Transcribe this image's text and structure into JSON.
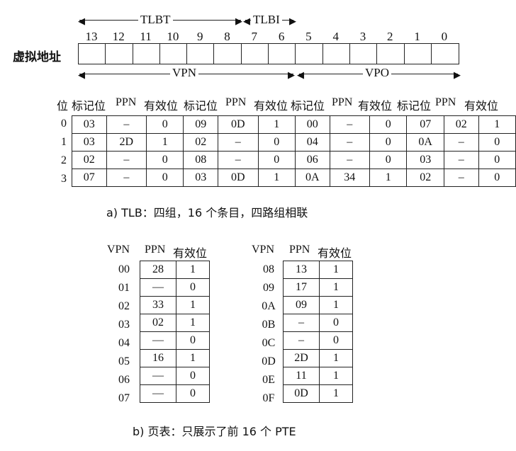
{
  "address": {
    "label": "虚拟地址",
    "bits": [
      "13",
      "12",
      "11",
      "10",
      "9",
      "8",
      "7",
      "6",
      "5",
      "4",
      "3",
      "2",
      "1",
      "0"
    ],
    "tlbt_label": "TLBT",
    "tlbi_label": "TLBI",
    "vpn_label": "VPN",
    "vpo_label": "VPO"
  },
  "tlb": {
    "set_header": "位",
    "columns": [
      "标记位",
      "PPN",
      "有效位",
      "标记位",
      "PPN",
      "有效位",
      "标记位",
      "PPN",
      "有效位",
      "标记位",
      "PPN",
      "有效位"
    ],
    "rows": [
      {
        "set": "0",
        "cells": [
          "03",
          "–",
          "0",
          "09",
          "0D",
          "1",
          "00",
          "–",
          "0",
          "07",
          "02",
          "1"
        ]
      },
      {
        "set": "1",
        "cells": [
          "03",
          "2D",
          "1",
          "02",
          "–",
          "0",
          "04",
          "–",
          "0",
          "0A",
          "–",
          "0"
        ]
      },
      {
        "set": "2",
        "cells": [
          "02",
          "–",
          "0",
          "08",
          "–",
          "0",
          "06",
          "–",
          "0",
          "03",
          "–",
          "0"
        ]
      },
      {
        "set": "3",
        "cells": [
          "07",
          "–",
          "0",
          "03",
          "0D",
          "1",
          "0A",
          "34",
          "1",
          "02",
          "–",
          "0"
        ]
      }
    ],
    "caption": "a) TLB：四组，16 个条目，四路组相联"
  },
  "page_table": {
    "headers": [
      "VPN",
      "PPN",
      "有效位"
    ],
    "left": [
      {
        "vpn": "00",
        "ppn": "28",
        "valid": "1"
      },
      {
        "vpn": "01",
        "ppn": "—",
        "valid": "0"
      },
      {
        "vpn": "02",
        "ppn": "33",
        "valid": "1"
      },
      {
        "vpn": "03",
        "ppn": "02",
        "valid": "1"
      },
      {
        "vpn": "04",
        "ppn": "—",
        "valid": "0"
      },
      {
        "vpn": "05",
        "ppn": "16",
        "valid": "1"
      },
      {
        "vpn": "06",
        "ppn": "—",
        "valid": "0"
      },
      {
        "vpn": "07",
        "ppn": "—",
        "valid": "0"
      }
    ],
    "right": [
      {
        "vpn": "08",
        "ppn": "13",
        "valid": "1"
      },
      {
        "vpn": "09",
        "ppn": "17",
        "valid": "1"
      },
      {
        "vpn": "0A",
        "ppn": "09",
        "valid": "1"
      },
      {
        "vpn": "0B",
        "ppn": "–",
        "valid": "0"
      },
      {
        "vpn": "0C",
        "ppn": "–",
        "valid": "0"
      },
      {
        "vpn": "0D",
        "ppn": "2D",
        "valid": "1"
      },
      {
        "vpn": "0E",
        "ppn": "11",
        "valid": "1"
      },
      {
        "vpn": "0F",
        "ppn": "0D",
        "valid": "1"
      }
    ],
    "caption": "b) 页表：只展示了前 16 个 PTE"
  }
}
